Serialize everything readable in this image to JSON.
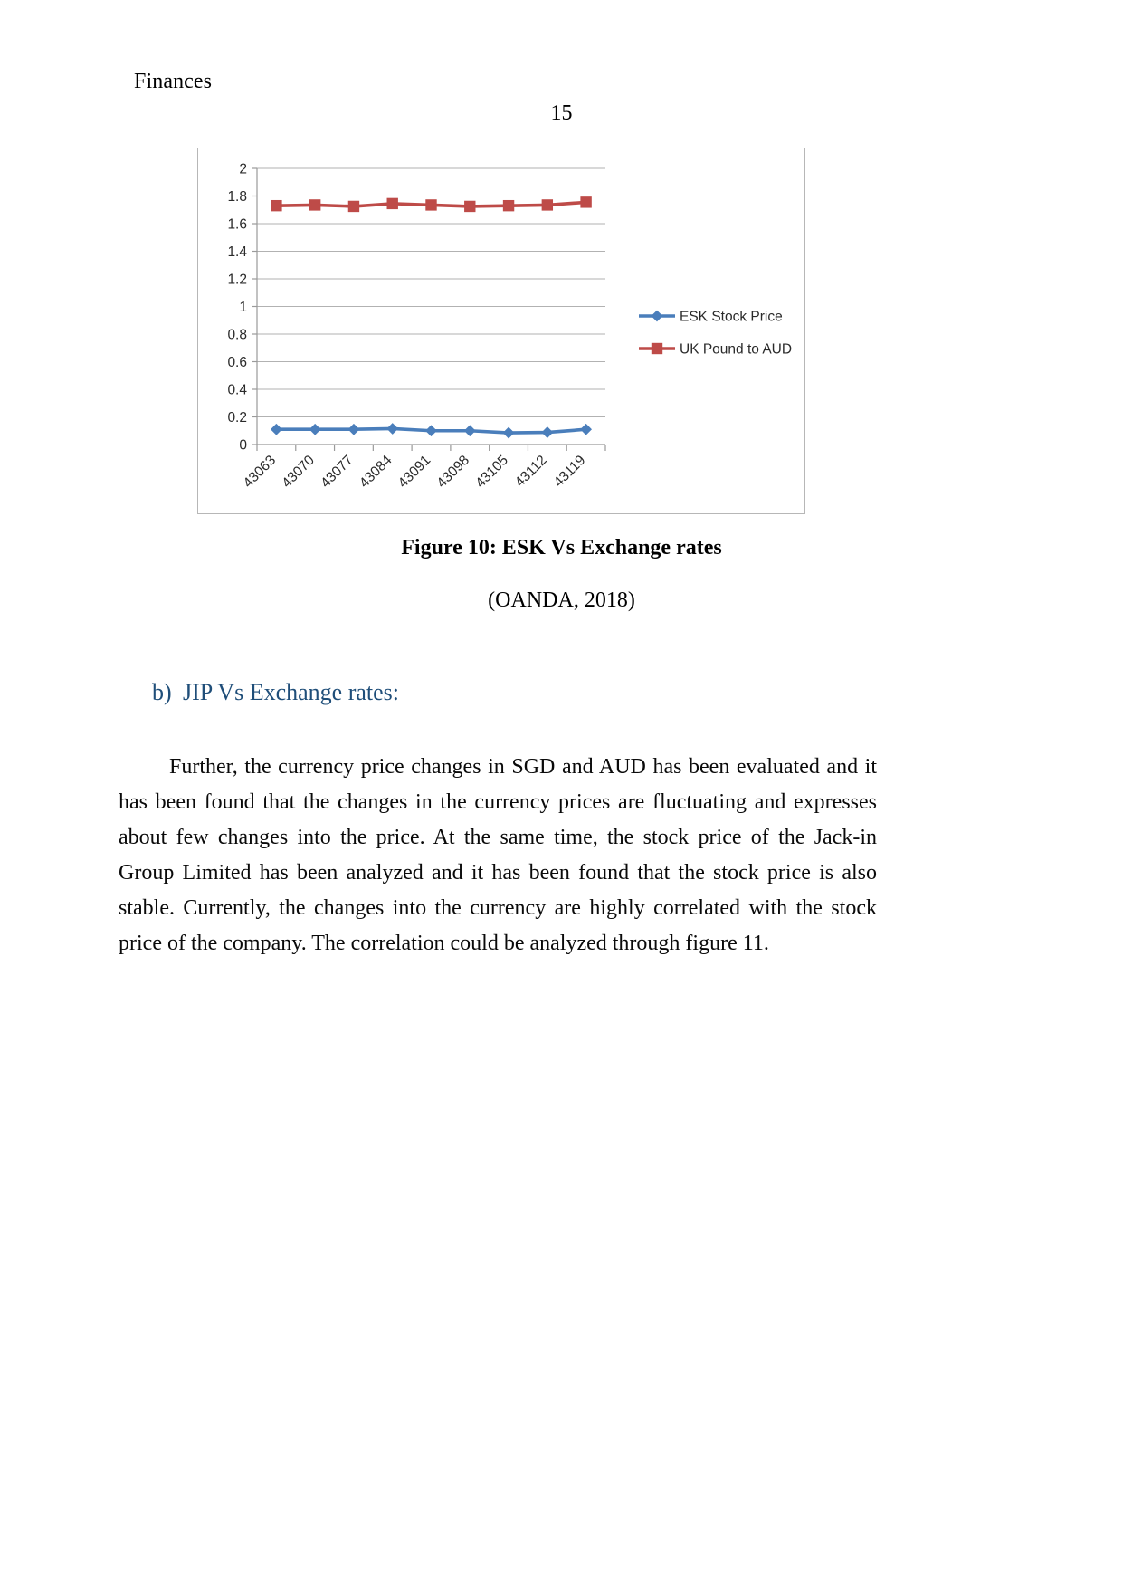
{
  "document": {
    "running_head": "Finances",
    "page_number": "15",
    "figure_caption": "Figure 10: ESK Vs Exchange rates",
    "source_citation": "(OANDA, 2018)",
    "heading": {
      "marker": "b)",
      "text": "JIP Vs Exchange rates",
      "colon": ":"
    },
    "paragraph": "Further, the currency price changes in SGD and AUD has been evaluated and it has been found that the changes in the currency prices are fluctuating and expresses about few changes into the price. At the same time, the stock price of the Jack-in Group Limited has been analyzed and it has been found that the stock price is also stable. Currently, the changes into the currency are highly correlated with the stock price of the company.  The correlation could be analyzed through figure 11."
  },
  "chart_data": {
    "type": "line",
    "title": "",
    "xlabel": "",
    "ylabel": "",
    "ylim": [
      0,
      2
    ],
    "ytick_step": 0.2,
    "grid": true,
    "legend_position": "right",
    "categories": [
      "43063",
      "43070",
      "43077",
      "43084",
      "43091",
      "43098",
      "43105",
      "43112",
      "43119"
    ],
    "ytick_labels": [
      "0",
      "0.2",
      "0.4",
      "0.6",
      "0.8",
      "1",
      "1.2",
      "1.4",
      "1.6",
      "1.8",
      "2"
    ],
    "series": [
      {
        "name": "ESK Stock Price",
        "color": "#4a7ebb",
        "marker": "diamond",
        "values": [
          0.11,
          0.11,
          0.11,
          0.115,
          0.1,
          0.1,
          0.085,
          0.088,
          0.11
        ]
      },
      {
        "name": "UK Pound to AUD",
        "color": "#be4b48",
        "marker": "square",
        "values": [
          1.73,
          1.735,
          1.725,
          1.745,
          1.735,
          1.725,
          1.73,
          1.735,
          1.755
        ]
      }
    ]
  }
}
